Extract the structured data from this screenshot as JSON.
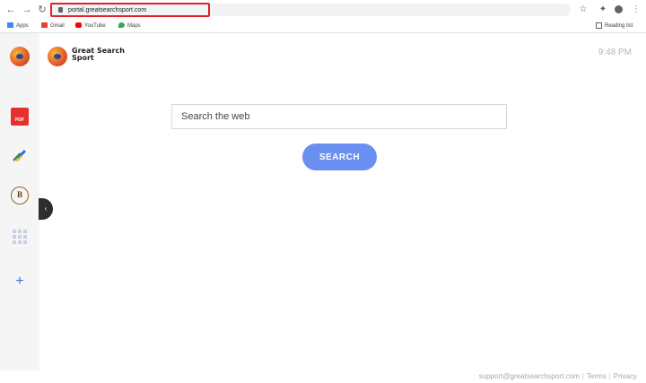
{
  "browser": {
    "url": "portal.greatsearchsport.com",
    "nav_icons": [
      "back-arrow-icon",
      "forward-arrow-icon",
      "reload-icon"
    ],
    "bookmarks": [
      {
        "label": "Apps",
        "icon": "apps-grid-icon",
        "color": "#4285f4"
      },
      {
        "label": "Gmail",
        "icon": "gmail-icon",
        "color": "#ea4335"
      },
      {
        "label": "YouTube",
        "icon": "youtube-icon",
        "color": "#ff0000"
      },
      {
        "label": "Maps",
        "icon": "maps-pin-icon",
        "color": "#34a853"
      }
    ],
    "reading_list": "Reading list",
    "accent_highlight": "#e0242a"
  },
  "sidebar": {
    "items": [
      {
        "name": "logo",
        "icon": "great-search-sport-logo-icon"
      },
      {
        "name": "pdf",
        "icon": "pdf-icon",
        "text": "PDF"
      },
      {
        "name": "link",
        "icon": "link-icon"
      },
      {
        "name": "bitcoin",
        "icon": "bitcoin-icon",
        "text": "B"
      },
      {
        "name": "grid",
        "icon": "grid-icon"
      },
      {
        "name": "add",
        "icon": "add-icon",
        "text": "+"
      }
    ],
    "collapse_glyph": "‹"
  },
  "header": {
    "brand_name": "Great Search Sport",
    "clock": "9:48 PM"
  },
  "search": {
    "placeholder": "Search the web",
    "button_label": "SEARCH",
    "button_color": "#6b8ff0"
  },
  "footer": {
    "email": "support@greatsearchsport.com",
    "terms": "Terms",
    "privacy": "Privacy"
  }
}
